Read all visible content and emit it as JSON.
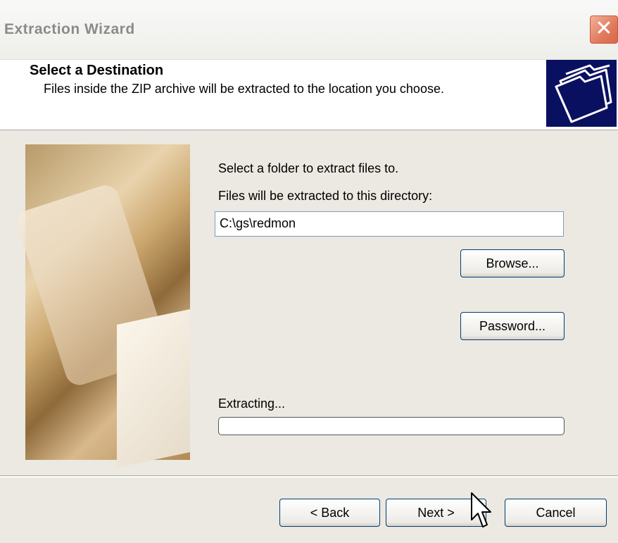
{
  "window": {
    "title": "Extraction Wizard",
    "close_glyph": "✕"
  },
  "header": {
    "title": "Select a Destination",
    "subtitle": "Files inside the ZIP archive will be extracted to the location you choose.",
    "icon": "folders-icon"
  },
  "main": {
    "instruction": "Select a folder to extract files to.",
    "dir_label": "Files will be extracted to this directory:",
    "dir_value": "C:\\gs\\redmon",
    "browse_label": "Browse...",
    "password_label": "Password...",
    "extracting_label": "Extracting...",
    "progress": 0
  },
  "footer": {
    "back_label": "< Back",
    "next_label": "Next >",
    "cancel_label": "Cancel"
  },
  "colors": {
    "header_icon_bg": "#0a1060",
    "close_button": "#e07a5c",
    "button_border": "#003c74"
  }
}
